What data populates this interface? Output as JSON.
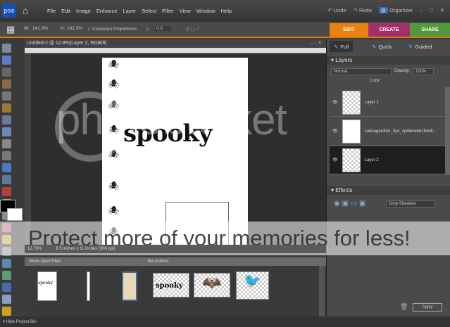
{
  "app": {
    "logo": "pse"
  },
  "menu": [
    "File",
    "Edit",
    "Image",
    "Enhance",
    "Layer",
    "Select",
    "Filter",
    "View",
    "Window",
    "Help"
  ],
  "topright": {
    "undo": "Undo",
    "redo": "Redo",
    "organizer": "Organizer"
  },
  "options": {
    "w_label": "W:",
    "w_value": "141.3%",
    "h_label": "H:",
    "h_value": "141.3%",
    "constrain": "Constrain Proportions",
    "angle": "0.0"
  },
  "modes": {
    "edit": "EDIT",
    "create": "CREATE",
    "share": "SHARE",
    "colors": {
      "edit": "#e8820f",
      "create": "#a3306a",
      "share": "#4f9a3a"
    }
  },
  "document": {
    "title": "Untitled-2 @ 12.8%(Layer 2, RGB/8)",
    "text": "spooky",
    "zoom": "12.76%",
    "size": "8.5 inches x 11 inches (300 ppi)"
  },
  "bin": {
    "show": "Show Open Files",
    "actions": "Bin Actions",
    "thumb_text": "spooky"
  },
  "bottom": {
    "hide": "Hide Project Bin"
  },
  "panel": {
    "tabs": [
      "Full",
      "Quick",
      "Guided"
    ],
    "layers_title": "Layers",
    "blend": "Normal",
    "opacity_label": "Opacity:",
    "opacity": "100%",
    "lock": "Lock:",
    "layers": [
      {
        "name": "Layer 1"
      },
      {
        "name": "carinagardner_3pc_spiderweb1thedi..."
      },
      {
        "name": "Layer 2"
      }
    ],
    "effects_title": "Effects",
    "effect_select": "Drop Shadows",
    "apply": "Apply"
  },
  "watermark": {
    "text": "Protect more of your memories for less!",
    "brand": "photobucket"
  }
}
